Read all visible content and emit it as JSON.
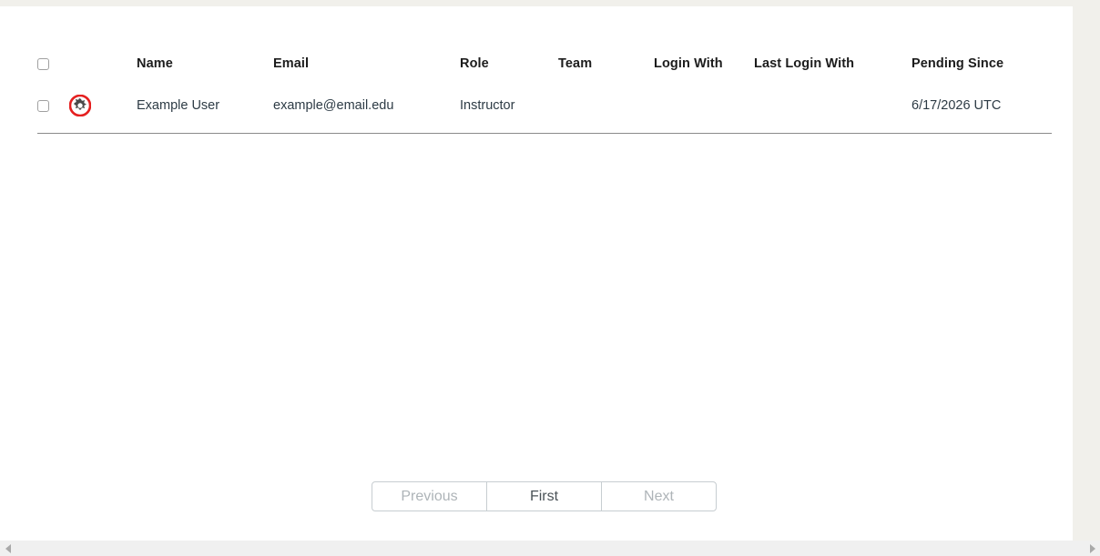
{
  "table": {
    "columns": [
      {
        "key": "select",
        "label": ""
      },
      {
        "key": "avatar",
        "label": ""
      },
      {
        "key": "name",
        "label": "Name"
      },
      {
        "key": "email",
        "label": "Email"
      },
      {
        "key": "role",
        "label": "Role"
      },
      {
        "key": "team",
        "label": "Team"
      },
      {
        "key": "login_with",
        "label": "Login With"
      },
      {
        "key": "last_login_with",
        "label": "Last Login With"
      },
      {
        "key": "pending_since",
        "label": "Pending Since"
      }
    ],
    "headers": {
      "name": "Name",
      "email": "Email",
      "role": "Role",
      "team": "Team",
      "login_with": "Login With",
      "last_login_with": "Last Login With",
      "pending_since": "Pending Since"
    },
    "rows": [
      {
        "selected": false,
        "avatar_icon": "gear-icon",
        "avatar_ring_color": "#e52020",
        "avatar_gear_color": "#4a4a4a",
        "name": "Example User",
        "email": "example@email.edu",
        "role": "Instructor",
        "team": "",
        "login_with": "",
        "last_login_with": "",
        "pending_since": "6/17/2026 UTC"
      }
    ],
    "select_all": false
  },
  "pagination": {
    "previous_label": "Previous",
    "current_label": "First",
    "next_label": "Next",
    "previous_disabled": true,
    "next_disabled": true
  },
  "scrollbar": {
    "left_arrow_icon": "triangle-left-icon",
    "right_arrow_icon": "triangle-right-icon"
  },
  "colors": {
    "accent_red": "#e52020",
    "page_background": "#ffffff",
    "gutter": "#f1f0eb",
    "header_text": "#1c1c1c",
    "body_text": "#2d3b45",
    "muted_text": "#aeb4b8",
    "border": "#8a8a8a"
  }
}
